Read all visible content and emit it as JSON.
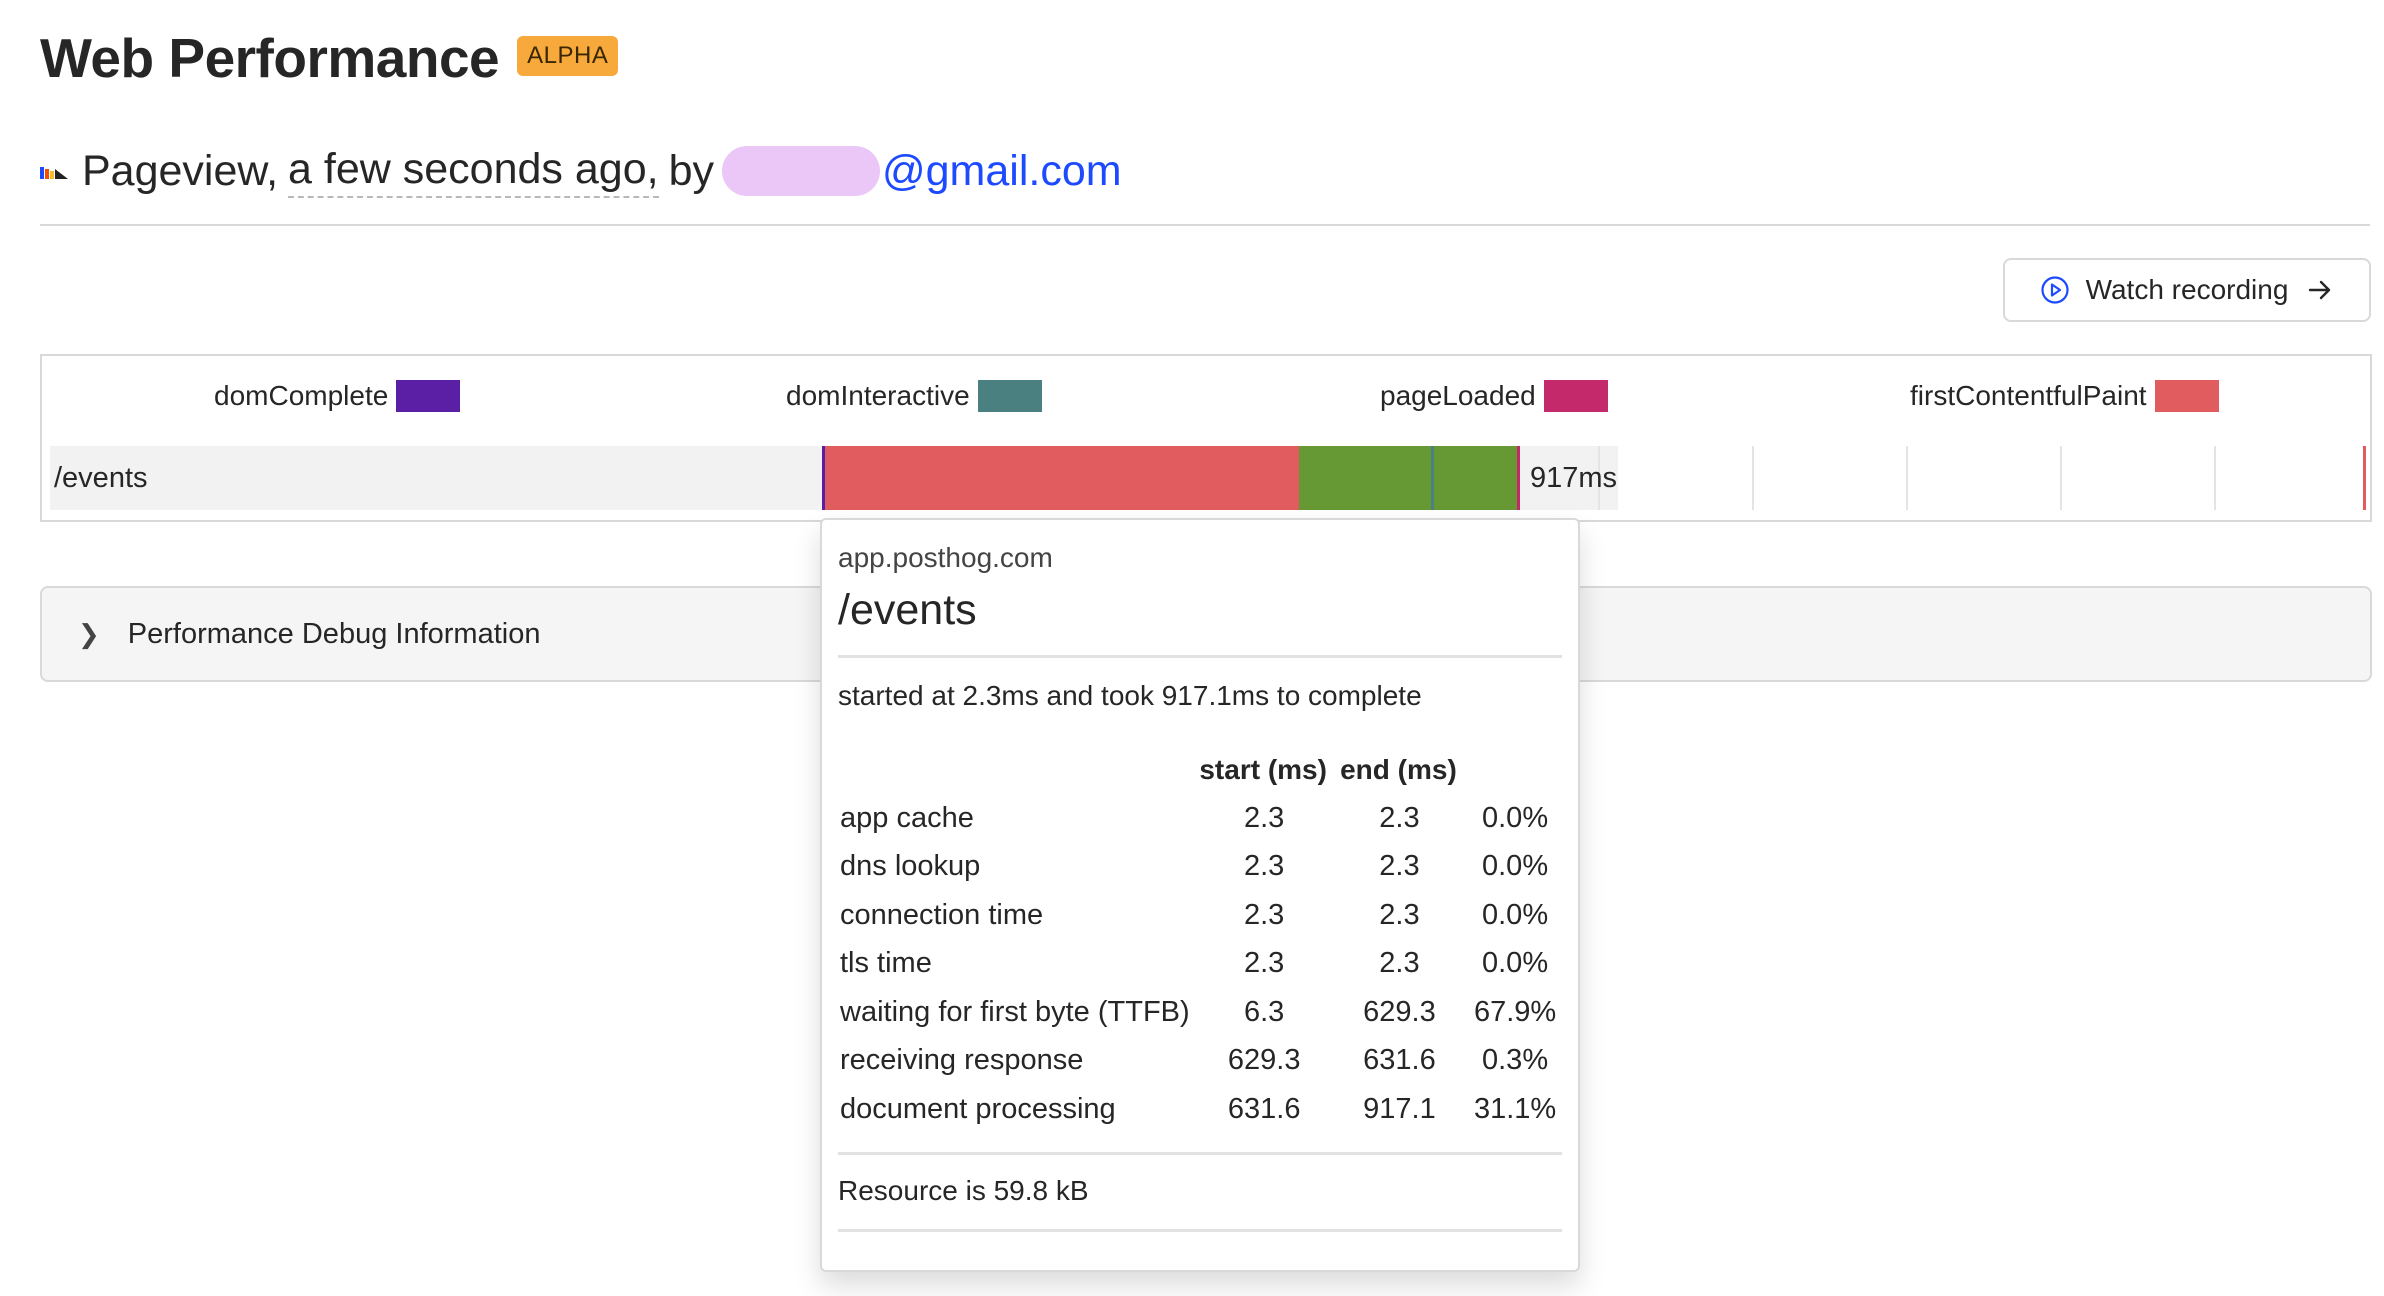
{
  "header": {
    "title": "Web Performance",
    "badge": "ALPHA"
  },
  "subtitle": {
    "event_icon": "pageview-icon",
    "event": "Pageview,",
    "time_ago": "a few seconds ago,",
    "by": "by",
    "email_suffix": "@gmail.com"
  },
  "actions": {
    "watch_recording": "Watch recording"
  },
  "legend": [
    {
      "label": "domComplete",
      "color": "#5b1fa6"
    },
    {
      "label": "domInteractive",
      "color": "#4a8080"
    },
    {
      "label": "pageLoaded",
      "color": "#c4296c"
    },
    {
      "label": "firstContentfulPaint",
      "color": "#e05c5e"
    }
  ],
  "waterfall": {
    "row_label": "/events",
    "duration": "917ms",
    "colors": {
      "waiting": "#e05c5e",
      "processing": "#669933"
    }
  },
  "debug": {
    "label": "Performance Debug Information"
  },
  "tooltip": {
    "host": "app.posthog.com",
    "path": "/events",
    "summary": "started at 2.3ms and took 917.1ms to complete",
    "columns": [
      "",
      "start (ms)",
      "end (ms)",
      ""
    ],
    "rows": [
      {
        "name": "app cache",
        "start": "2.3",
        "end": "2.3",
        "pct": "0.0%"
      },
      {
        "name": "dns lookup",
        "start": "2.3",
        "end": "2.3",
        "pct": "0.0%"
      },
      {
        "name": "connection time",
        "start": "2.3",
        "end": "2.3",
        "pct": "0.0%"
      },
      {
        "name": "tls time",
        "start": "2.3",
        "end": "2.3",
        "pct": "0.0%"
      },
      {
        "name": "waiting for first byte (TTFB)",
        "start": "6.3",
        "end": "629.3",
        "pct": "67.9%"
      },
      {
        "name": "receiving response",
        "start": "629.3",
        "end": "631.6",
        "pct": "0.3%"
      },
      {
        "name": "document processing",
        "start": "631.6",
        "end": "917.1",
        "pct": "31.1%"
      }
    ],
    "resource": "Resource is 59.8 kB"
  }
}
